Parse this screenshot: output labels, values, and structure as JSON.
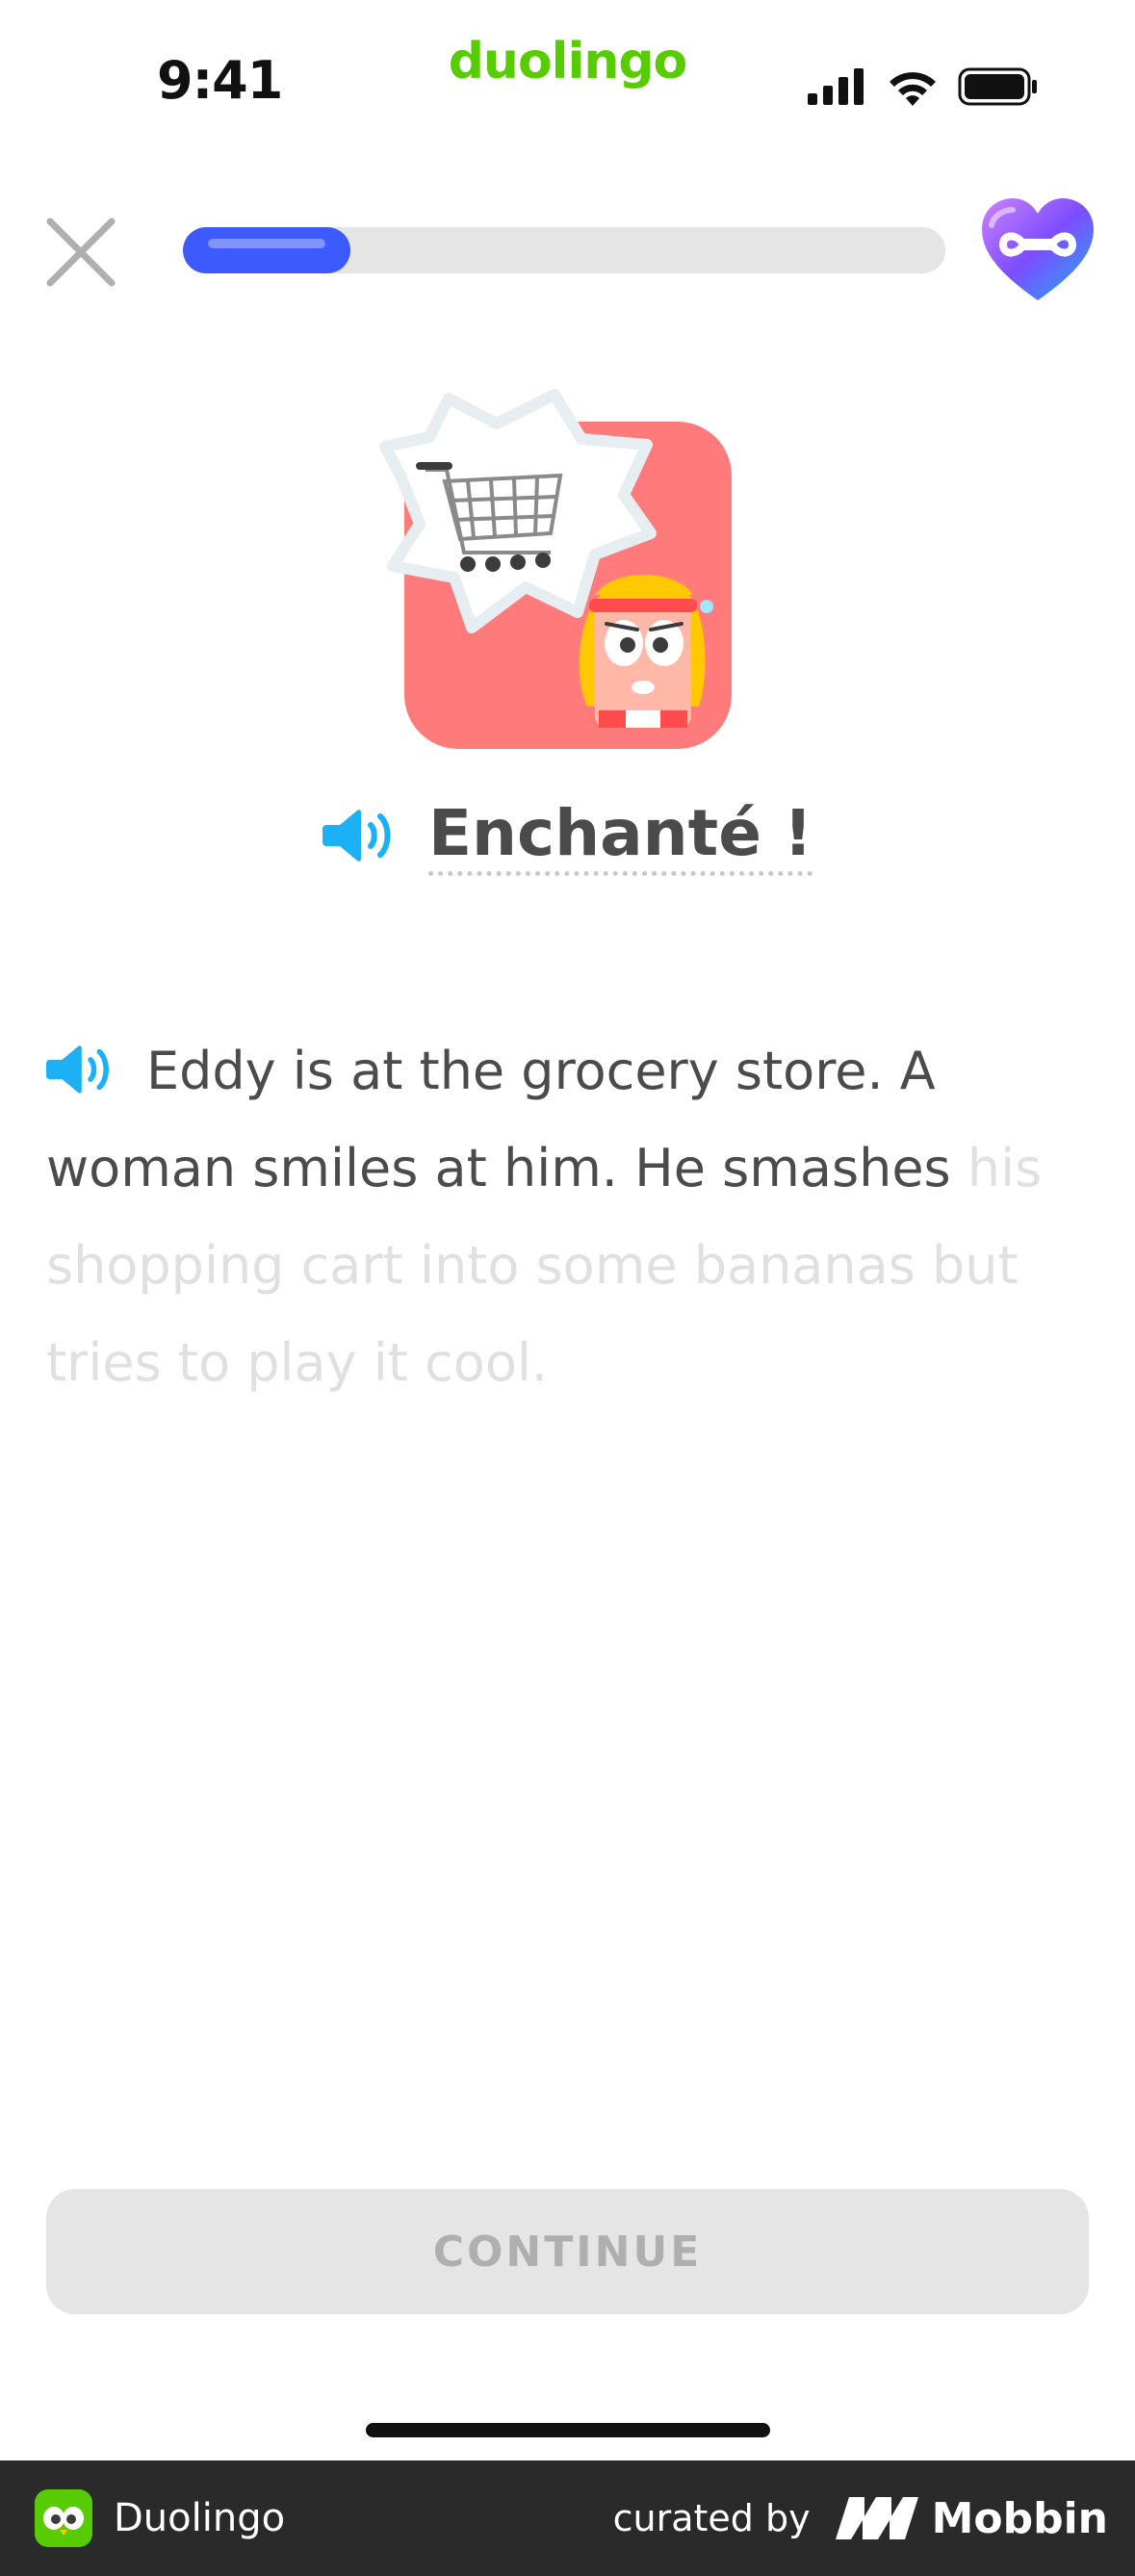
{
  "status_bar": {
    "time": "9:41",
    "brand": "duolingo",
    "icons": [
      "signal-icon",
      "wifi-icon",
      "battery-icon"
    ]
  },
  "lesson": {
    "progress": 0.22,
    "progress_color": "#3d5afe",
    "hearts": "∞",
    "heart_icon": "infinity-heart-icon",
    "close_icon": "close-icon"
  },
  "illustration": {
    "icon": "eddy-shopping-cart-illustration"
  },
  "phrase": {
    "text": "Enchanté !",
    "icon": "speaker-icon"
  },
  "story": {
    "revealed": "Eddy is at the grocery store. A woman smiles at him. He smashes",
    "hidden": "his shopping cart into some bananas but tries to play it cool.",
    "icon": "speaker-icon"
  },
  "continue_button": {
    "label": "CONTINUE"
  },
  "footer": {
    "app_name": "Duolingo",
    "curated_by": "curated by",
    "brand": "Mobbin"
  },
  "colors": {
    "accent_green": "#58cc02",
    "speaker_blue": "#1cb0f6",
    "illustration_bg": "#ff7b7b"
  }
}
